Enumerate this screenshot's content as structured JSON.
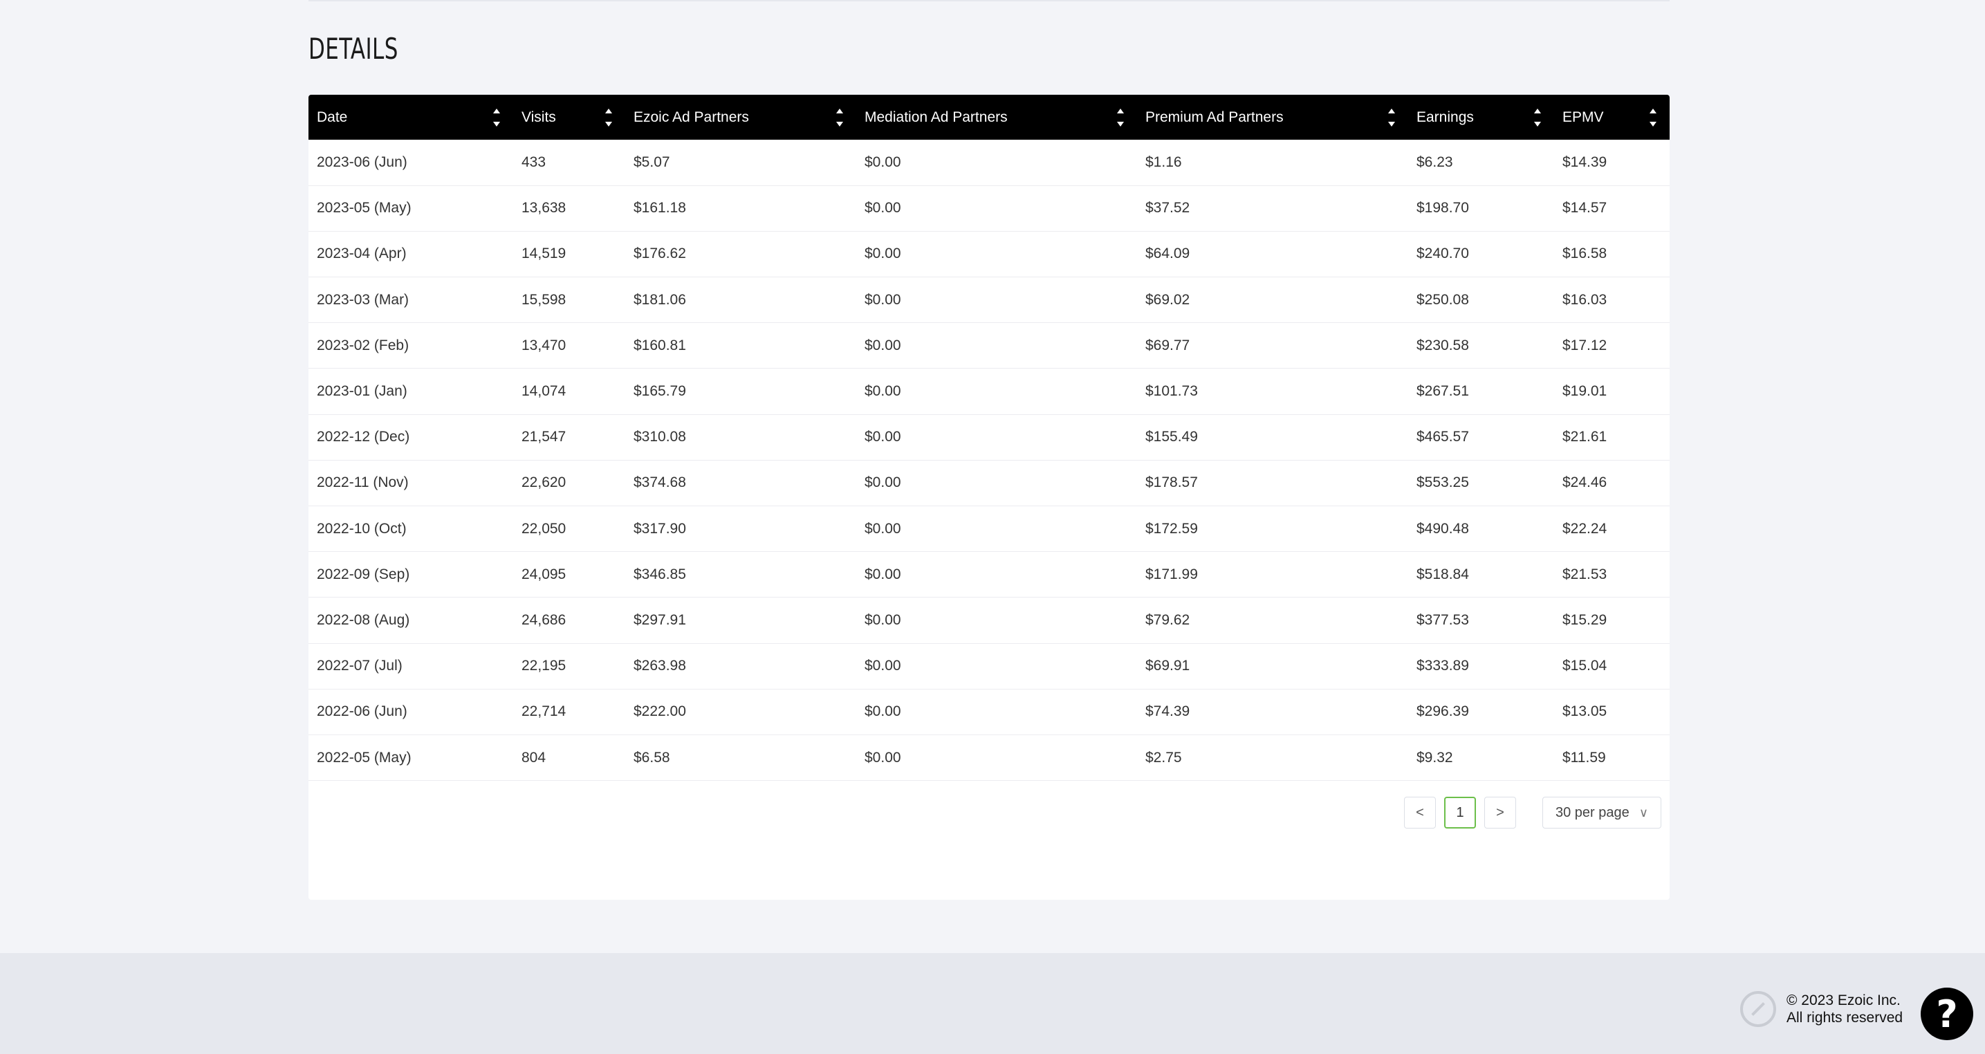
{
  "section": {
    "title": "DETAILS"
  },
  "table": {
    "headers": [
      "Date",
      "Visits",
      "Ezoic Ad Partners",
      "Mediation Ad Partners",
      "Premium Ad Partners",
      "Earnings",
      "EPMV"
    ],
    "rows": [
      [
        "2023-06 (Jun)",
        "433",
        "$5.07",
        "$0.00",
        "$1.16",
        "$6.23",
        "$14.39"
      ],
      [
        "2023-05 (May)",
        "13,638",
        "$161.18",
        "$0.00",
        "$37.52",
        "$198.70",
        "$14.57"
      ],
      [
        "2023-04 (Apr)",
        "14,519",
        "$176.62",
        "$0.00",
        "$64.09",
        "$240.70",
        "$16.58"
      ],
      [
        "2023-03 (Mar)",
        "15,598",
        "$181.06",
        "$0.00",
        "$69.02",
        "$250.08",
        "$16.03"
      ],
      [
        "2023-02 (Feb)",
        "13,470",
        "$160.81",
        "$0.00",
        "$69.77",
        "$230.58",
        "$17.12"
      ],
      [
        "2023-01 (Jan)",
        "14,074",
        "$165.79",
        "$0.00",
        "$101.73",
        "$267.51",
        "$19.01"
      ],
      [
        "2022-12 (Dec)",
        "21,547",
        "$310.08",
        "$0.00",
        "$155.49",
        "$465.57",
        "$21.61"
      ],
      [
        "2022-11 (Nov)",
        "22,620",
        "$374.68",
        "$0.00",
        "$178.57",
        "$553.25",
        "$24.46"
      ],
      [
        "2022-10 (Oct)",
        "22,050",
        "$317.90",
        "$0.00",
        "$172.59",
        "$490.48",
        "$22.24"
      ],
      [
        "2022-09 (Sep)",
        "24,095",
        "$346.85",
        "$0.00",
        "$171.99",
        "$518.84",
        "$21.53"
      ],
      [
        "2022-08 (Aug)",
        "24,686",
        "$297.91",
        "$0.00",
        "$79.62",
        "$377.53",
        "$15.29"
      ],
      [
        "2022-07 (Jul)",
        "22,195",
        "$263.98",
        "$0.00",
        "$69.91",
        "$333.89",
        "$15.04"
      ],
      [
        "2022-06 (Jun)",
        "22,714",
        "$222.00",
        "$0.00",
        "$74.39",
        "$296.39",
        "$13.05"
      ],
      [
        "2022-05 (May)",
        "804",
        "$6.58",
        "$0.00",
        "$2.75",
        "$9.32",
        "$11.59"
      ]
    ]
  },
  "pagination": {
    "prev_icon": "chevron-left-icon",
    "next_icon": "chevron-right-icon",
    "current_page": "1",
    "per_page": "30 per page",
    "prev_glyph": "<",
    "next_glyph": ">",
    "dropdown_glyph": "∨"
  },
  "footer": {
    "copyright_line1": "© 2023 Ezoic Inc.",
    "copyright_line2": "All rights reserved",
    "help_label": "?"
  },
  "colors": {
    "header_bg": "#000000",
    "page_bg": "#f3f4f8",
    "active_page_border": "#6cbf4a"
  }
}
